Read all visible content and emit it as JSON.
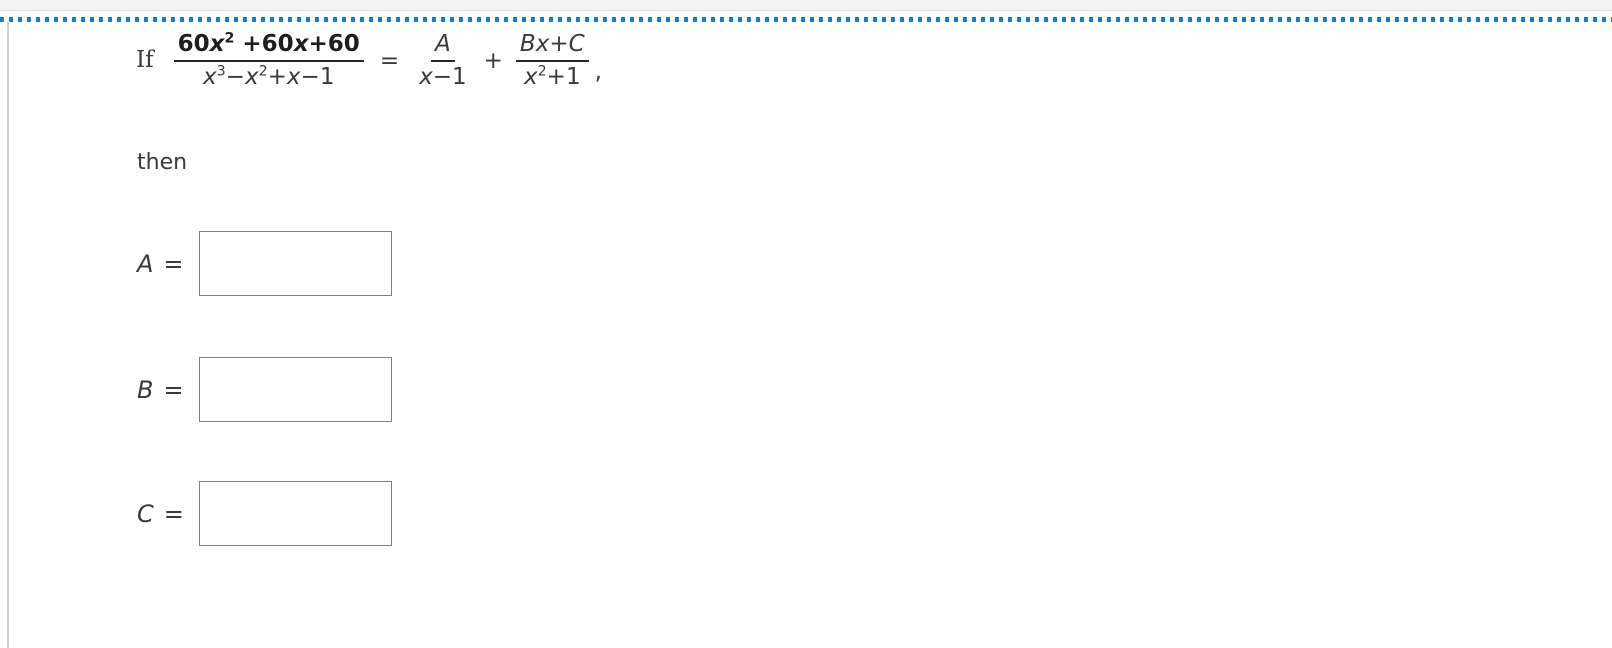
{
  "page": {
    "background_color": "#ffffff",
    "text_color": "#3a3a3a",
    "accent_color": "#1a7ad4",
    "rule_color": "#d4d4d4",
    "input_border_color": "#808080"
  },
  "problem": {
    "if_word": "If",
    "then_word": "then",
    "equation": {
      "left_fraction": {
        "numerator": {
          "parts": [
            {
              "text": "60",
              "style": "upright"
            },
            {
              "text": "x",
              "style": "italic"
            },
            {
              "text": "2",
              "style": "superscript"
            },
            {
              "text": " +60",
              "style": "upright"
            },
            {
              "text": "x",
              "style": "italic"
            },
            {
              "text": "+60",
              "style": "upright"
            }
          ],
          "plain": "60x^2 +60x+60"
        },
        "denominator": {
          "parts": [
            {
              "text": "x",
              "style": "italic"
            },
            {
              "text": "3",
              "style": "superscript"
            },
            {
              "text": "−",
              "style": "upright"
            },
            {
              "text": "x",
              "style": "italic"
            },
            {
              "text": "2",
              "style": "superscript"
            },
            {
              "text": "+",
              "style": "upright"
            },
            {
              "text": "x",
              "style": "italic"
            },
            {
              "text": "−1",
              "style": "upright"
            }
          ],
          "plain": "x^3-x^2+x-1"
        }
      },
      "equals_sign": "=",
      "first_term": {
        "numerator": {
          "plain": "A"
        },
        "denominator": {
          "plain": "x-1"
        }
      },
      "plus_sign": "+",
      "second_term": {
        "numerator": {
          "plain": "Bx+C"
        },
        "denominator": {
          "plain": "x^2+1"
        }
      },
      "trailing_punctuation": ","
    }
  },
  "answers": [
    {
      "id": "a",
      "label": "A",
      "equals": "=",
      "value": "",
      "placeholder": ""
    },
    {
      "id": "b",
      "label": "B",
      "equals": "=",
      "value": "",
      "placeholder": ""
    },
    {
      "id": "c",
      "label": "C",
      "equals": "=",
      "value": "",
      "placeholder": ""
    }
  ]
}
